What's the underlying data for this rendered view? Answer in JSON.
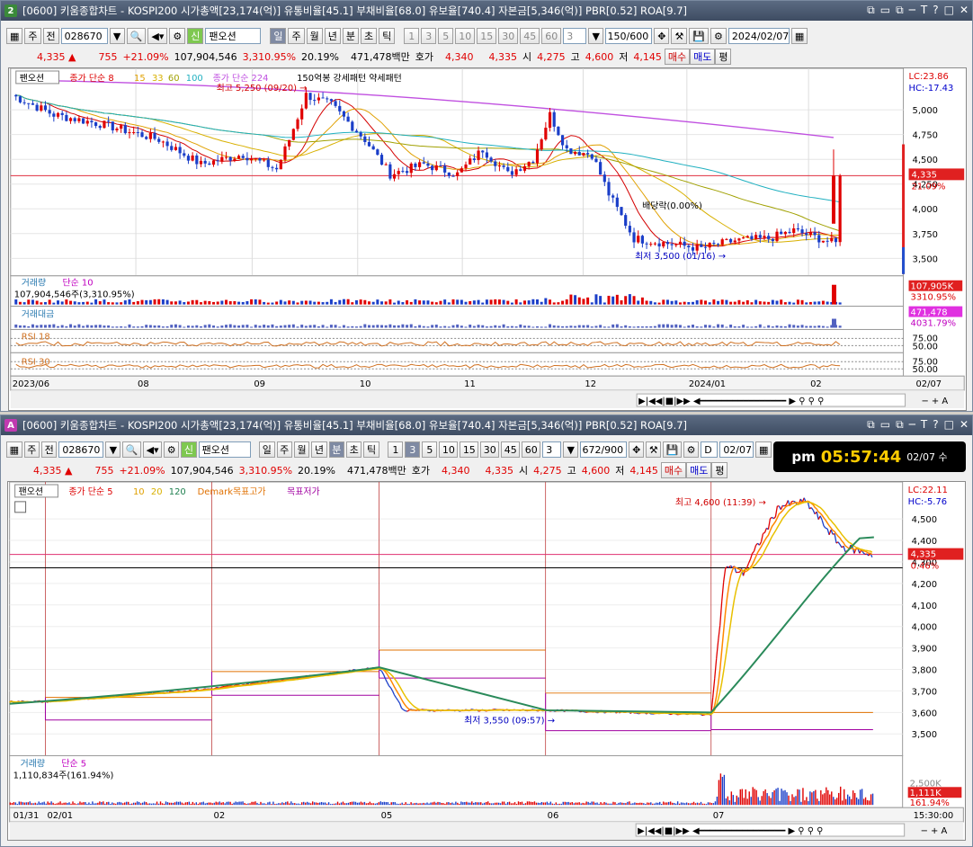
{
  "top": {
    "window_num": "2",
    "title": "[0600] 키움종합차트 - KOSPI200 시가총액[23,174(억)] 유통비율[45.1] 부채비율[68.0] 유보율[740.4] 자본금[5,346(억)] PBR[0.52] ROA[9.7]",
    "toolbar": {
      "period_type": "주",
      "prev": "전",
      "code": "028670",
      "name": "팬오션",
      "sin": "신",
      "tabs": [
        "일",
        "주",
        "월",
        "년",
        "분",
        "초",
        "틱"
      ],
      "active_tab": "일",
      "nums": [
        "1",
        "3",
        "5",
        "10",
        "15",
        "30",
        "45",
        "60"
      ],
      "n_sel": "3",
      "count": "150/600",
      "date": "2024/02/07"
    },
    "quote": {
      "price": "4,335 ▲",
      "change": "755",
      "pct": "+21.09%",
      "volume": "107,904,546",
      "vol_pct": "3,310.95%",
      "turnover": "20.19%",
      "amount": "471,478백만",
      "hoga_label": "호가",
      "bid1": "4,340",
      "bid2": "4,335",
      "open_label": "시",
      "open": "4,275",
      "high_label": "고",
      "high": "4,600",
      "low_label": "저",
      "low": "4,145",
      "buy": "매수",
      "sell": "매도",
      "pyeong": "평"
    },
    "legend": {
      "name": "팬오션",
      "ma_label": "종가 단순 8",
      "ma2": "15",
      "ma3": "33",
      "ma4": "60",
      "ma5": "100",
      "ma6_label": "종가 단순 224",
      "patterns": "150억봉 강세패턴 약세패턴"
    },
    "annotations": {
      "high": "최고 5,250 (09/20) →",
      "low": "최저 3,500 (01/16) →",
      "ex_div": "배당락(0.00%)"
    },
    "right_labels": {
      "lc": "LC:23.86",
      "hc": "HC:-17.43",
      "price": "4,335",
      "pct": "21.09%",
      "vol": "107,905K",
      "vol_pct": "3310.95%",
      "amt": "471,478",
      "amt_pct": "4031.79%"
    },
    "y_ticks": [
      "5,000",
      "4,750",
      "4,500",
      "4,250",
      "4,000",
      "3,750",
      "3,500"
    ],
    "x_ticks": [
      "2023/06",
      "08",
      "09",
      "10",
      "11",
      "12",
      "2024/01",
      "02",
      "02/07"
    ],
    "vol_panel": {
      "label": "거래량",
      "sub": "단순 10",
      "value": "107,904,546주(3,310.95%)"
    },
    "amt_panel": {
      "label": "거래대금"
    },
    "rsi1": {
      "label": "RSI 18",
      "a": "75.00",
      "b": "50.00"
    },
    "rsi2": {
      "label": "RSI 30",
      "a": "75.00",
      "b": "50.00"
    }
  },
  "bottom": {
    "window_num": "A",
    "title": "[0600] 키움종합차트 - KOSPI200 시가총액[23,174(억)] 유통비율[45.1] 부채비율[68.0] 유보율[740.4] 자본금[5,346(억)] PBR[0.52] ROA[9.7]",
    "toolbar": {
      "period_type": "주",
      "prev": "전",
      "code": "028670",
      "name": "팬오션",
      "sin": "신",
      "tabs": [
        "일",
        "주",
        "월",
        "년",
        "분",
        "초",
        "틱"
      ],
      "active_tab": "분",
      "nums": [
        "1",
        "3",
        "5",
        "10",
        "15",
        "30",
        "45",
        "60"
      ],
      "active_num": "3",
      "n_sel": "3",
      "count": "672/900",
      "date": "02/07",
      "chk": "D"
    },
    "clock": {
      "ampm": "pm",
      "time": "05:57:44",
      "date": "02/07 수"
    },
    "legend": {
      "name": "팬오션",
      "ma_label": "종가 단순 5",
      "ma2": "10",
      "ma3": "20",
      "ma4": "120",
      "demark_hi": "Demark목표고가",
      "demark_lo": "목표저가"
    },
    "annotations": {
      "high": "최고 4,600 (11:39) →",
      "low": "최저 3,550 (09:57) →"
    },
    "right_labels": {
      "lc": "LC:22.11",
      "hc": "HC:-5.76",
      "price": "4,335",
      "pct": "0.46%",
      "vol": "1,111K",
      "vol_pct": "161.94%",
      "vtick": "2,500K"
    },
    "y_ticks": [
      "4,500",
      "4,400",
      "4,300",
      "4,200",
      "4,100",
      "4,000",
      "3,900",
      "3,800",
      "3,700",
      "3,600",
      "3,500"
    ],
    "x_ticks": [
      "01/31",
      "02/01",
      "02",
      "05",
      "06",
      "07",
      "15:30:00"
    ],
    "vol_panel": {
      "label": "거래량",
      "sub": "단순 5",
      "value": "1,110,834주(161.94%)"
    }
  },
  "colors": {
    "up": "#e00000",
    "down": "#1a3ec8",
    "ma8": "#d40000",
    "ma15": "#e0a000",
    "ma33": "#d8b000",
    "ma60": "#a0a000",
    "ma100": "#20b0c0",
    "ma224": "#c050e0",
    "bg": "#ffffff",
    "grid": "#c8c8c8"
  }
}
